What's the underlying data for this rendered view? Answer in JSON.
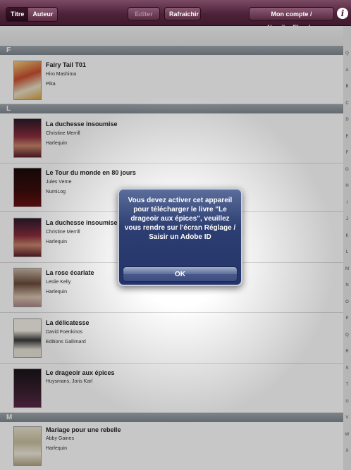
{
  "toolbar": {
    "segment": {
      "titre": "Titre",
      "auteur": "Auteur"
    },
    "edit_label": "Editer",
    "refresh_label": "Rafraichir",
    "account_label": "Mon compte / NumilogEbooks",
    "colors": {
      "toolbar": "#4e2239"
    }
  },
  "sections": {
    "f": "F",
    "l": "L",
    "m": "M"
  },
  "books": [
    {
      "title": "Fairy Tail T01",
      "author": "Hiro Mashima",
      "publisher": "Pika"
    },
    {
      "title": "La duchesse insoumise",
      "author": "Christine Merrill",
      "publisher": "Harlequin"
    },
    {
      "title": "Le Tour du monde en 80 jours",
      "author": "Jules Verne",
      "publisher": "NumiLog"
    },
    {
      "title": "La duchesse insoumise",
      "author": "Christine Merrill",
      "publisher": "Harlequin"
    },
    {
      "title": "La rose écarlate",
      "author": "Leslie Kelly",
      "publisher": "Harlequin"
    },
    {
      "title": "La délicatesse",
      "author": "David Foenkinos",
      "publisher": "Editions Gallimard"
    },
    {
      "title": "Le drageoir aux épices",
      "author": "Huysmans, Joris Karl",
      "publisher": ""
    },
    {
      "title": "Mariage pour une rebelle",
      "author": "Abby Gaines",
      "publisher": "Harlequin"
    }
  ],
  "index": [
    "Q",
    "A",
    "B",
    "C",
    "D",
    "E",
    "F",
    "G",
    "H",
    "I",
    "J",
    "K",
    "L",
    "M",
    "N",
    "O",
    "P",
    "Q",
    "R",
    "S",
    "T",
    "U",
    "V",
    "W",
    "X"
  ],
  "alert": {
    "message": "Vous devez activer cet appareil pour télécharger le livre \"Le drageoir aux épices\", veuillez vous rendre sur l'écran Réglage / Saisir un Adobe ID",
    "ok_label": "OK"
  }
}
